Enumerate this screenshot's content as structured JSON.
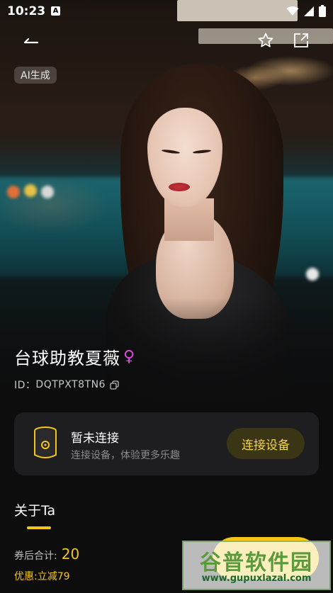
{
  "status_bar": {
    "time": "10:23",
    "notification_icon": "A",
    "icons": [
      "wifi-icon",
      "signal-icon",
      "battery-icon"
    ]
  },
  "header": {
    "back_icon": "back-arrow-icon",
    "favorite_icon": "star-icon",
    "share_icon": "share-icon",
    "ai_badge": "AI生成"
  },
  "profile": {
    "name": "台球助教夏薇",
    "gender_symbol": "♀",
    "id_label": "ID：",
    "id_value": "DQTPXT8TN6",
    "copy_icon": "copy-icon"
  },
  "device_card": {
    "title": "暂未连接",
    "subtitle": "连接设备，体验更多乐趣",
    "button_label": "连接设备",
    "device_icon": "device-icon"
  },
  "about": {
    "title": "关于Ta"
  },
  "purchase": {
    "total_label": "券后合计:",
    "total_value": "20",
    "discount": "优惠:立减79"
  },
  "watermark": {
    "title": "谷普软件园",
    "url": "www.gupuxlazal.com"
  },
  "colors": {
    "accent": "#f5c518",
    "gender": "#d94bd8",
    "card_bg": "#1e1e20",
    "page_bg": "#0d0d0e"
  }
}
